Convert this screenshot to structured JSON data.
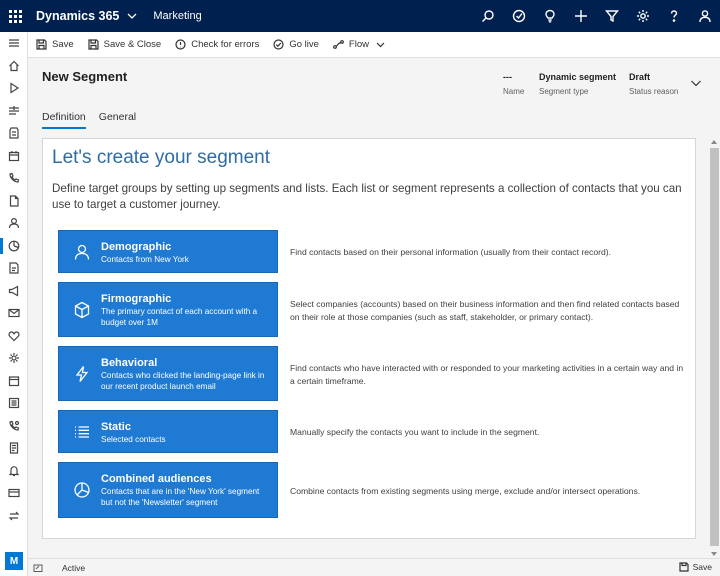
{
  "topbar": {
    "app_name": "Dynamics 365",
    "area_name": "Marketing",
    "icons": [
      "search-icon",
      "assistant-icon",
      "lightbulb-icon",
      "plus-icon",
      "filter-icon",
      "gear-icon",
      "help-icon",
      "user-icon"
    ]
  },
  "nav": {
    "icons": [
      "hamburger-icon",
      "home-icon",
      "play-icon",
      "pin-icon",
      "journeys-icon",
      "calendar-icon",
      "phone-icon",
      "document-icon",
      "contact-icon",
      "segment-icon",
      "forms-icon",
      "megaphone-icon",
      "email-icon",
      "heart-icon",
      "gear-icon",
      "events-icon",
      "list-icon",
      "calls-icon",
      "report-icon",
      "bell-icon",
      "card-icon",
      "switch-icon"
    ],
    "avatar_initial": "M"
  },
  "commandbar": {
    "save": "Save",
    "save_close": "Save & Close",
    "check_errors": "Check for errors",
    "go_live": "Go live",
    "flow": "Flow"
  },
  "header": {
    "title": "New Segment",
    "fields": [
      {
        "value": "---",
        "label": "Name"
      },
      {
        "value": "Dynamic segment",
        "label": "Segment type"
      },
      {
        "value": "Draft",
        "label": "Status reason"
      }
    ],
    "tabs": [
      "Definition",
      "General"
    ]
  },
  "card": {
    "title": "Let's create your segment",
    "description": "Define target groups by setting up segments and lists. Each list or segment represents a collection of contacts that you can use to target a customer journey.",
    "options": [
      {
        "name": "Demographic",
        "subtitle": "Contacts from New York",
        "description": "Find contacts based on their personal information (usually from their contact record).",
        "icon": "person-icon"
      },
      {
        "name": "Firmographic",
        "subtitle": "The primary contact of each account with a budget over 1M",
        "description": "Select companies (accounts) based on their business information and then find related contacts based on their role at those companies (such as staff, stakeholder, or primary contact).",
        "icon": "cube-icon"
      },
      {
        "name": "Behavioral",
        "subtitle": "Contacts who clicked the landing-page link in our recent product launch email",
        "description": "Find contacts who have interacted with or responded to your marketing activities in a certain way and in a certain timeframe.",
        "icon": "lightning-icon"
      },
      {
        "name": "Static",
        "subtitle": "Selected contacts",
        "description": "Manually specify the contacts you want to include in the segment.",
        "icon": "list-icon"
      },
      {
        "name": "Combined audiences",
        "subtitle": "Contacts that are in the 'New York' segment but not the 'Newsletter' segment",
        "description": "Combine contacts from existing segments using merge, exclude and/or intersect operations.",
        "icon": "pie-icon"
      }
    ]
  },
  "statusbar": {
    "status": "Active",
    "save": "Save"
  }
}
